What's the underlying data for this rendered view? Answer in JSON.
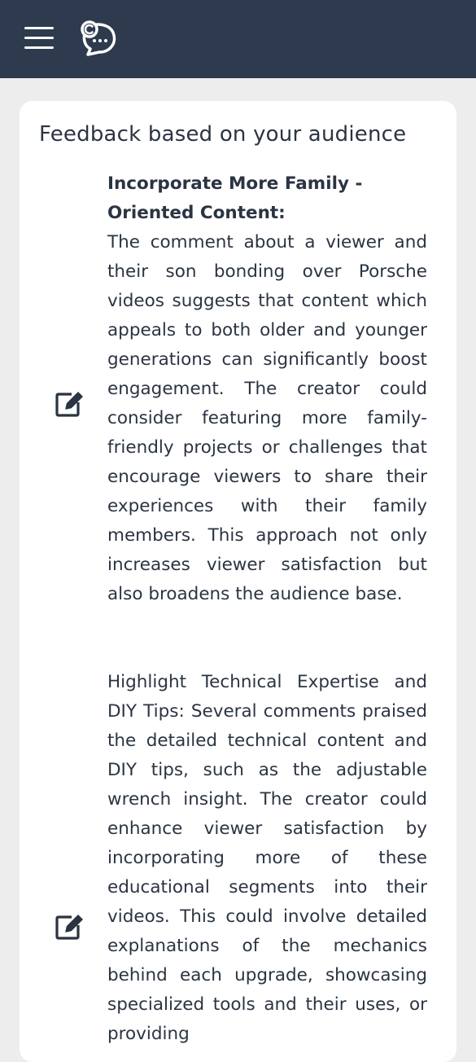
{
  "header": {
    "menu_icon": "hamburger-menu-icon",
    "logo_icon": "chat-bubble-logo-icon",
    "background": "#2e3b4e"
  },
  "feedback": {
    "title": "Feedback based on your audience",
    "edit_icon": "edit-icon",
    "items": [
      {
        "heading": "Incorporate More Family - Oriented Content:",
        "body": "The comment about a viewer and their son bonding over Porsche videos suggests that content which appeals to both older and younger generations can significantly boost engagement. The creator could consider featuring more family-friendly projects or challenges that encourage viewers to share their experiences with their family members. This approach not only increases viewer satisfaction but also broadens the audience base."
      },
      {
        "body": "Highlight Technical Expertise and DIY Tips: Several comments praised the detailed technical content and DIY tips, such as the adjustable wrench insight. The creator could enhance viewer satisfaction by incorporating more of these educational segments into their videos. This could involve detailed explanations of the mechanics behind each upgrade, showcasing specialized tools and their uses, or providing"
      }
    ]
  }
}
